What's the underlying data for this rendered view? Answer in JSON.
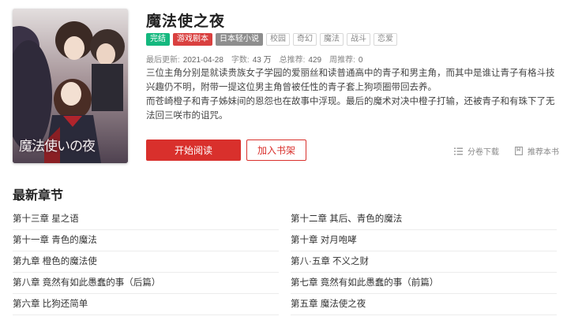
{
  "book": {
    "title": "魔法使之夜",
    "cover_title": "魔法使いの夜",
    "tags": [
      "完结",
      "游戏剧本",
      "日本轻小说",
      "校园",
      "奇幻",
      "魔法",
      "战斗",
      "恋爱"
    ],
    "meta": {
      "updated_label": "最后更新:",
      "updated_value": "2021-04-28",
      "words_label": "字数:",
      "words_value": "43 万",
      "total_rec_label": "总推荐:",
      "total_rec_value": "429",
      "week_rec_label": "周推荐:",
      "week_rec_value": "0"
    },
    "description": [
      "三位主角分别是就读贵族女子学园的爱丽丝和读普通高中的青子和男主角，而其中是谁让青子有格斗技兴趣仍不明，附带一提这位男主角曾被任性的青子套上狗项圈带回去养。",
      "而苍崎橙子和青子姊妹间的恩怨也在故事中浮现。最后的魔术对决中橙子打输，还被青子和有珠下了无法回三咲市的诅咒。"
    ]
  },
  "actions": {
    "read_label": "开始阅读",
    "shelf_label": "加入书架",
    "download_label": "分卷下载",
    "recommend_label": "推荐本书",
    "download_icon": "list-icon",
    "recommend_icon": "bookmark-icon"
  },
  "latest": {
    "heading": "最新章节",
    "chapters": [
      "第十三章 星之语",
      "第十二章 其后、青色的魔法",
      "第十一章 青色的魔法",
      "第十章 对月咆哮",
      "第九章 橙色的魔法使",
      "第八·五章 不义之财",
      "第八章 竟然有如此愚蠢的事（后篇）",
      "第七章 竟然有如此愚蠢的事（前篇）",
      "第六章 比狗还简单",
      "第五章 魔法使之夜"
    ]
  },
  "colors": {
    "accent": "#d9302c",
    "tag_complete": "#14b87e",
    "tag_script": "#d9403f",
    "tag_lightnovel": "#8e8e8e"
  }
}
